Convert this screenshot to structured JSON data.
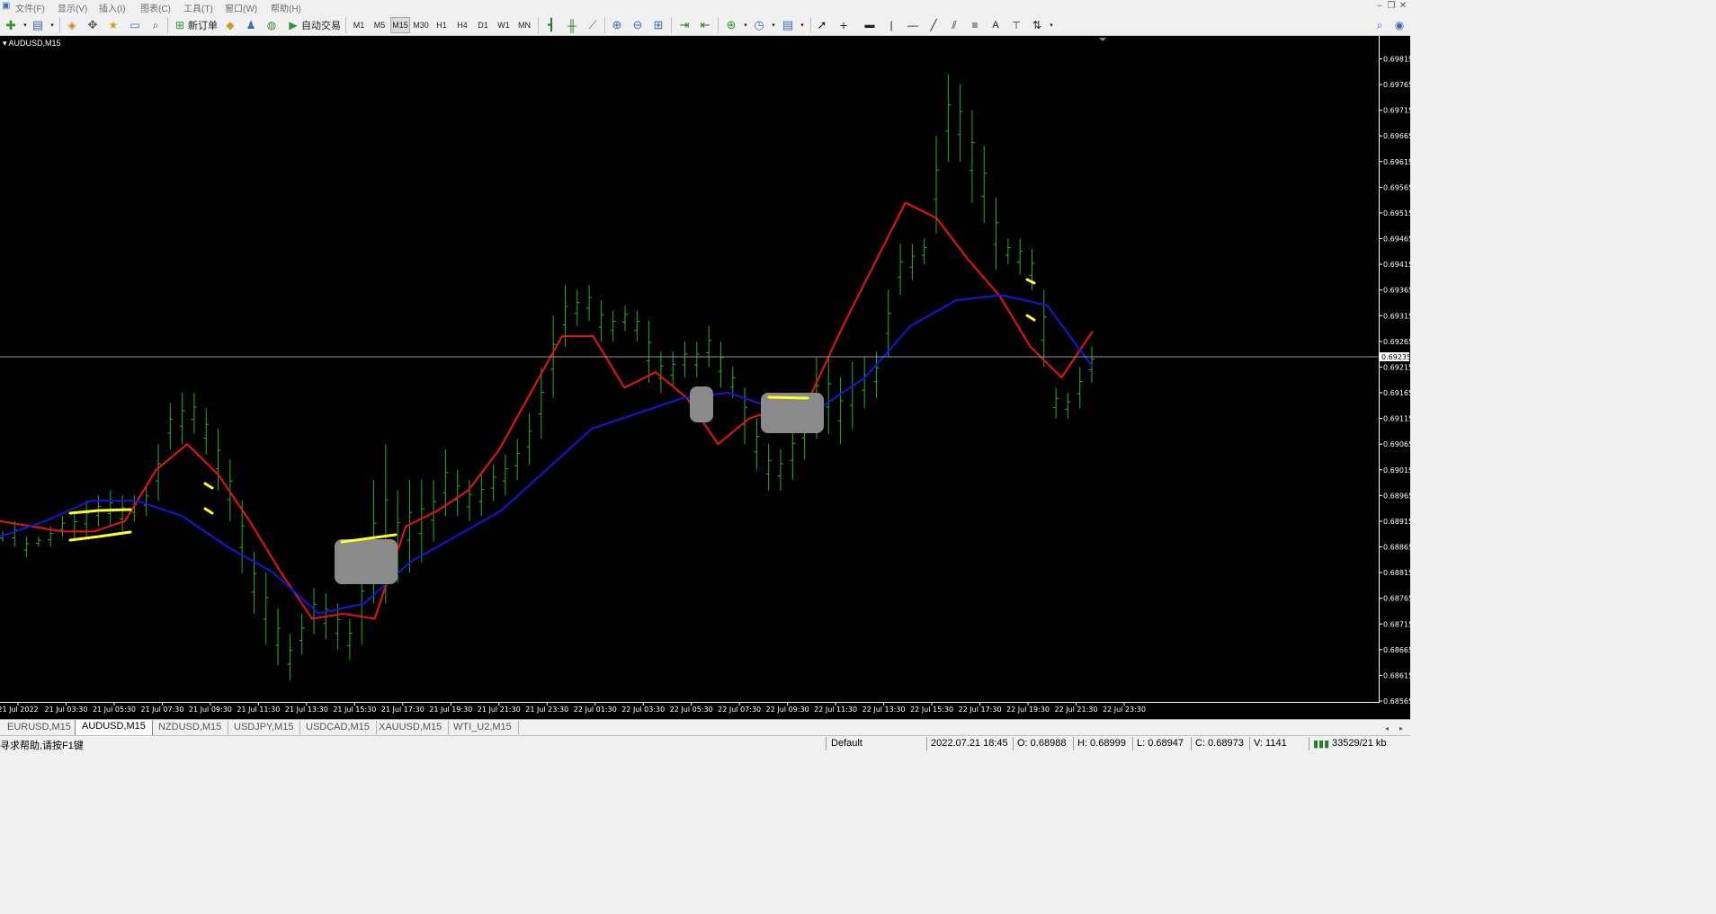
{
  "menu": [
    "文件(F)",
    "显示(V)",
    "插入(I)",
    "图表(C)",
    "工具(T)",
    "窗口(W)",
    "帮助(H)"
  ],
  "toolbar": {
    "new_order": "新订单",
    "auto_trading": "自动交易",
    "timeframes": [
      "M1",
      "M5",
      "M15",
      "M30",
      "H1",
      "H4",
      "D1",
      "W1",
      "MN"
    ],
    "active_timeframe": "M15",
    "text_tool": "A"
  },
  "chart": {
    "symbol_label": "AUDUSD,M15",
    "current_price_label": "0.69235",
    "colors": {
      "bg": "#000000",
      "bars": "#22b022",
      "ma_fast": "#ee1111",
      "ma_slow": "#1515e0",
      "highlight": "#ffff22",
      "mask": "#8a8a8a",
      "axis": "#ffffff",
      "current_line": "#8f9aa6"
    }
  },
  "chart_data": {
    "type": "bar",
    "y_ticks": [
      "0.69815",
      "0.69765",
      "0.69715",
      "0.69665",
      "0.69615",
      "0.69565",
      "0.69515",
      "0.69465",
      "0.69415",
      "0.69365",
      "0.69315",
      "0.69265",
      "0.69215",
      "0.69165",
      "0.69115",
      "0.69065",
      "0.69015",
      "0.68965",
      "0.68915",
      "0.68865",
      "0.68815",
      "0.68765",
      "0.68715",
      "0.68665",
      "0.68615",
      "0.68565"
    ],
    "ylim": [
      0.68565,
      0.69835
    ],
    "x_ticks": [
      "21 Jul 2022",
      "21 Jul 03:30",
      "21 Jul 05:30",
      "21 Jul 07:30",
      "21 Jul 09:30",
      "21 Jul 11:30",
      "21 Jul 13:30",
      "21 Jul 15:30",
      "21 Jul 17:30",
      "21 Jul 19:30",
      "21 Jul 21:30",
      "21 Jul 23:30",
      "22 Jul 01:30",
      "22 Jul 03:30",
      "22 Jul 05:30",
      "22 Jul 07:30",
      "22 Jul 09:30",
      "22 Jul 11:30",
      "22 Jul 13:30",
      "22 Jul 15:30",
      "22 Jul 17:30",
      "22 Jul 19:30",
      "22 Jul 21:30",
      "22 Jul 23:30"
    ],
    "current_price": 0.69235,
    "series": [
      {
        "values": [
          [
            0.68875,
            0.68895
          ],
          [
            0.68865,
            0.68915
          ],
          [
            0.68845,
            0.68885
          ],
          [
            0.68865,
            0.68885
          ],
          [
            0.68865,
            0.68905
          ],
          [
            0.68885,
            0.68925
          ],
          [
            0.68875,
            0.68935
          ],
          [
            0.68885,
            0.68955
          ],
          [
            0.68905,
            0.68965
          ],
          [
            0.68905,
            0.68975
          ],
          [
            0.68895,
            0.68965
          ],
          [
            0.68915,
            0.68965
          ],
          [
            0.68925,
            0.68985
          ],
          [
            0.68955,
            0.69065
          ],
          [
            0.69055,
            0.69145
          ],
          [
            0.69065,
            0.69165
          ],
          [
            0.69085,
            0.69165
          ],
          [
            0.69045,
            0.69135
          ],
          [
            0.68975,
            0.69095
          ],
          [
            0.68915,
            0.69035
          ],
          [
            0.68815,
            0.68955
          ],
          [
            0.68735,
            0.68855
          ],
          [
            0.68675,
            0.68815
          ],
          [
            0.68635,
            0.68745
          ],
          [
            0.68605,
            0.68695
          ],
          [
            0.68655,
            0.68735
          ],
          [
            0.68695,
            0.68785
          ],
          [
            0.68685,
            0.68775
          ],
          [
            0.68665,
            0.68755
          ],
          [
            0.68645,
            0.68725
          ],
          [
            0.68675,
            0.68835
          ],
          [
            0.68755,
            0.68995
          ],
          [
            0.68755,
            0.69065
          ],
          [
            0.68795,
            0.68975
          ],
          [
            0.68815,
            0.68995
          ],
          [
            0.68835,
            0.68995
          ],
          [
            0.68875,
            0.68995
          ],
          [
            0.68925,
            0.69055
          ],
          [
            0.68925,
            0.69015
          ],
          [
            0.68915,
            0.68995
          ],
          [
            0.68925,
            0.69005
          ],
          [
            0.68955,
            0.69025
          ],
          [
            0.68965,
            0.69045
          ],
          [
            0.68995,
            0.69075
          ],
          [
            0.69025,
            0.69125
          ],
          [
            0.69075,
            0.69215
          ],
          [
            0.69155,
            0.69315
          ],
          [
            0.69255,
            0.69375
          ],
          [
            0.69295,
            0.69365
          ],
          [
            0.69305,
            0.69375
          ],
          [
            0.69265,
            0.69345
          ],
          [
            0.69265,
            0.69325
          ],
          [
            0.69285,
            0.69335
          ],
          [
            0.69265,
            0.69325
          ],
          [
            0.69185,
            0.69305
          ],
          [
            0.69165,
            0.69245
          ],
          [
            0.69175,
            0.69245
          ],
          [
            0.69195,
            0.69265
          ],
          [
            0.69195,
            0.69265
          ],
          [
            0.69215,
            0.69295
          ],
          [
            0.69175,
            0.69265
          ],
          [
            0.69155,
            0.69215
          ],
          [
            0.69065,
            0.69175
          ],
          [
            0.69015,
            0.69115
          ],
          [
            0.68975,
            0.69065
          ],
          [
            0.68975,
            0.69055
          ],
          [
            0.68995,
            0.69105
          ],
          [
            0.69035,
            0.69155
          ],
          [
            0.69075,
            0.69235
          ],
          [
            0.69085,
            0.69235
          ],
          [
            0.69065,
            0.69195
          ],
          [
            0.69095,
            0.69225
          ],
          [
            0.69135,
            0.69235
          ],
          [
            0.69155,
            0.69245
          ],
          [
            0.69235,
            0.69365
          ],
          [
            0.69355,
            0.69455
          ],
          [
            0.69385,
            0.69455
          ],
          [
            0.69415,
            0.69465
          ],
          [
            0.69475,
            0.69665
          ],
          [
            0.69615,
            0.69785
          ],
          [
            0.69615,
            0.69765
          ],
          [
            0.69535,
            0.69715
          ],
          [
            0.69495,
            0.69645
          ],
          [
            0.69405,
            0.69545
          ],
          [
            0.69415,
            0.69465
          ],
          [
            0.69395,
            0.69465
          ],
          [
            0.69365,
            0.69445
          ],
          [
            0.69215,
            0.69365
          ],
          [
            0.69115,
            0.69175
          ],
          [
            0.69115,
            0.69165
          ],
          [
            0.69135,
            0.69215
          ],
          [
            0.69185,
            0.69255
          ]
        ]
      },
      {
        "values": [
          0.68915,
          0.68905,
          0.68895,
          0.68895,
          0.68915,
          0.69015,
          0.69065,
          0.69005,
          0.68915,
          0.68815,
          0.68725,
          0.68735,
          0.68725,
          0.68905,
          0.68935,
          0.68975,
          0.69055,
          0.69165,
          0.69275,
          0.69275,
          0.69175,
          0.69205,
          0.69155,
          0.69065,
          0.69115,
          0.69135,
          0.69165,
          0.69295,
          0.69415,
          0.69535,
          0.69505,
          0.69425,
          0.69355,
          0.69255,
          0.69195,
          0.69285
        ]
      },
      {
        "values": [
          0.68885,
          0.68915,
          0.68955,
          0.68955,
          0.68925,
          0.68865,
          0.68815,
          0.68735,
          0.68755,
          0.68835,
          0.68885,
          0.68935,
          0.69015,
          0.69095,
          0.69125,
          0.69155,
          0.69165,
          0.69135,
          0.69135,
          0.69195,
          0.69295,
          0.69345,
          0.69355,
          0.69335,
          0.69215
        ]
      }
    ]
  },
  "tabs": [
    "EURUSD,M15",
    "AUDUSD,M15",
    "NZDUSD,M15",
    "USDJPY,M15",
    "USDCAD,M15",
    "XAUUSD,M15",
    "WTI_U2,M15"
  ],
  "active_tab": "AUDUSD,M15",
  "status": {
    "help": "寻求帮助,请按F1键",
    "profile": "Default",
    "datetime": "2022.07.21 18:45",
    "open": "O: 0.68988",
    "high": "H: 0.68999",
    "low": "L: 0.68947",
    "close": "C: 0.68973",
    "volume": "V: 1141",
    "traffic": "33529/21 kb"
  }
}
